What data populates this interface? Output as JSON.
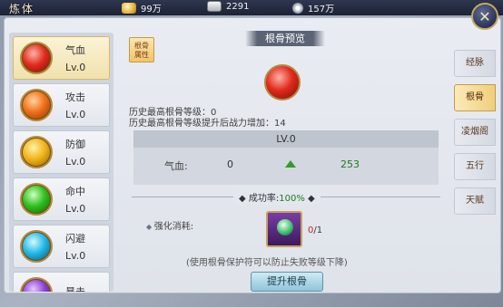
{
  "window": {
    "title": "炼体"
  },
  "resources": [
    {
      "icon": "gold-ingot-icon",
      "value": "99万"
    },
    {
      "icon": "silver-ingot-icon",
      "value": "2291"
    },
    {
      "icon": "token-icon",
      "value": "157万"
    }
  ],
  "attributes": [
    {
      "name": "气血",
      "level": "Lv.0",
      "color": "red",
      "selected": true
    },
    {
      "name": "攻击",
      "level": "Lv.0",
      "color": "orange",
      "selected": false
    },
    {
      "name": "防御",
      "level": "Lv.0",
      "color": "yellow",
      "selected": false
    },
    {
      "name": "命中",
      "level": "Lv.0",
      "color": "green",
      "selected": false
    },
    {
      "name": "闪避",
      "level": "Lv.0",
      "color": "cyan",
      "selected": false
    },
    {
      "name": "暴击",
      "level": "",
      "color": "purple",
      "selected": false
    }
  ],
  "content": {
    "tag_line1": "根骨",
    "tag_line2": "属性",
    "preview_title": "根骨预览",
    "history_level_label": "历史最高根骨等级：",
    "history_level_value": "0",
    "history_power_label": "历史最高根骨等级提升后战力增加：",
    "history_power_value": "14",
    "table_level": "LV.0",
    "stat_name": "气血:",
    "stat_current": "0",
    "stat_next": "253",
    "success_rate_label": "成功率:",
    "success_rate_value": "100%",
    "cost_label": "强化消耗:",
    "item_have": "0",
    "item_need": "/1",
    "hint": "(使用根骨保护符可以防止失败等级下降)",
    "upgrade_button": "提升根骨"
  },
  "tabs": [
    {
      "label": "经脉",
      "active": false
    },
    {
      "label": "根骨",
      "active": true
    },
    {
      "label": "凌烟阁",
      "active": false
    },
    {
      "label": "五行",
      "active": false
    },
    {
      "label": "天赋",
      "active": false
    }
  ]
}
